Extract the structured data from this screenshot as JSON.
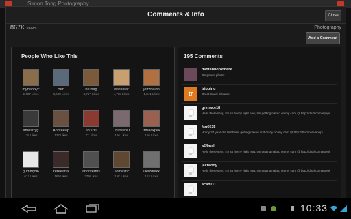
{
  "background": {
    "app_title": "Simon Tong Photography"
  },
  "dialog": {
    "title": "Comments & Info",
    "close_label": "Close",
    "views_count": "867K",
    "views_label": "views",
    "category": "Photography",
    "add_comment_label": "Add a Comment"
  },
  "likes": {
    "title": "People Who Like This",
    "users": [
      {
        "name": "myhappyc",
        "likes": "2,407 Likes",
        "color": "#8a6d4a"
      },
      {
        "name": "Ben",
        "likes": "3,608 Likes",
        "color": "#5a6a7a"
      },
      {
        "name": "brunag",
        "likes": "3,767 Likes",
        "color": "#7a5a3a"
      },
      {
        "name": "eliviastar",
        "likes": "1,718 Likes",
        "color": "#c8a070"
      },
      {
        "name": "jeffzheldo",
        "likes": "1,841 Likes",
        "color": "#b07040"
      },
      {
        "name": "amosrryg",
        "likes": "118 Likes",
        "color": "#3a3a3a"
      },
      {
        "name": "Andreeap",
        "likes": "127 Likes",
        "color": "#6a5040"
      },
      {
        "name": "riot131",
        "likes": "77 Likes",
        "color": "#8a3a30"
      },
      {
        "name": "ThirteenD",
        "likes": "156 Likes",
        "color": "#7a6a70"
      },
      {
        "name": "Irmaakpek",
        "likes": "156 Likes",
        "color": "#9a6050"
      },
      {
        "name": "gummy96",
        "likes": "612 Likes",
        "color": "#e8e8e8"
      },
      {
        "name": "rereeana",
        "likes": "165 Likes",
        "color": "#3a2a2a"
      },
      {
        "name": "abonterms",
        "likes": "279 Likes",
        "color": "#505050"
      },
      {
        "name": "Domestic",
        "likes": "15K Likes",
        "color": "#604830"
      },
      {
        "name": "Deizdlexx",
        "likes": "162 Likes",
        "color": "#707070"
      }
    ]
  },
  "comments": {
    "title": "195 Comments",
    "items": [
      {
        "name": "dvdfabbookmark",
        "text": "Gorgeous photo!",
        "avatar": "photo"
      },
      {
        "name": "tripping",
        "text": "Great travel pictures.",
        "avatar": "tr"
      },
      {
        "name": "grimace18",
        "text": "Hello there sexy, I'm so horny right now, I'm getting naked on my cam @ http://dturl.com/epepi",
        "avatar": "bulb"
      },
      {
        "name": "fsu6635",
        "text": "Horny 27 year old slut here, getting naked and crazy on my cam @ http://dturl.com/epepi",
        "avatar": "bulb"
      },
      {
        "name": "a54mel",
        "text": "Hello there sexy, I'm so horny right now, I'm getting naked on my cam @ http://dturl.com/epepi",
        "avatar": "bulb"
      },
      {
        "name": "jachrody",
        "text": "Hello there sexy, I'm so horny right now, I'm getting naked on my cam @ http://dturl.com/epepi",
        "avatar": "bulb"
      },
      {
        "name": "acah111",
        "text": "",
        "avatar": "bulb"
      }
    ]
  },
  "statusbar": {
    "time": "10:33"
  }
}
